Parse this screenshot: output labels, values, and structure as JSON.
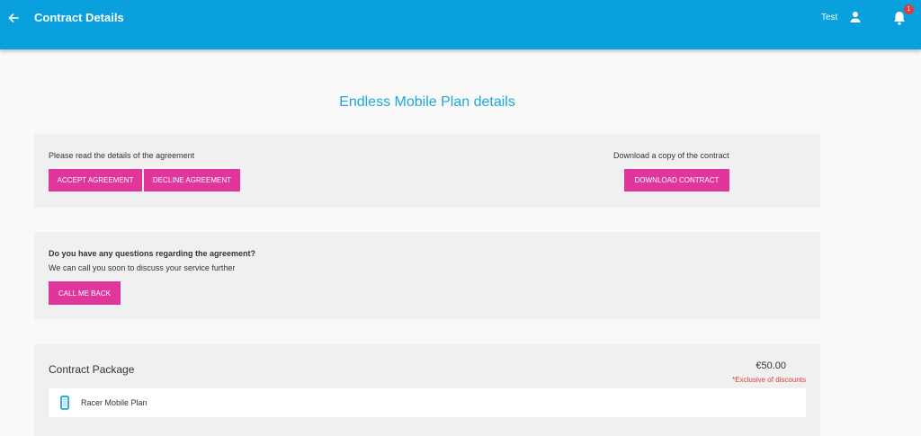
{
  "header": {
    "title": "Contract Details",
    "user_name": "Test",
    "notification_count": "1",
    "back_icon": "arrow-left-icon",
    "user_icon": "person-icon",
    "notification_icon": "bell-icon"
  },
  "page": {
    "heading": "Endless Mobile Plan details"
  },
  "agreement": {
    "read_text": "Please read the details of the agreement",
    "accept_label": "ACCEPT AGREEMENT",
    "decline_label": "DECLINE AGREEMENT",
    "download_text": "Download a copy of the contract",
    "download_label": "DOWNLOAD CONTRACT"
  },
  "questions": {
    "title": "Do you have any questions regarding the agreement?",
    "subtitle": "We can call you soon to discuss your service further",
    "call_label": "CALL ME BACK"
  },
  "package": {
    "title": "Contract Package",
    "price": "€50.00",
    "note": "*Exclusive of discounts",
    "items": [
      {
        "name": "Racer Mobile Plan",
        "icon": "mobile-phone-icon"
      }
    ]
  },
  "colors": {
    "header": "#0aa0dd",
    "accent_button": "#e0359a",
    "heading": "#1ba8dc",
    "note_red": "#e53935"
  }
}
